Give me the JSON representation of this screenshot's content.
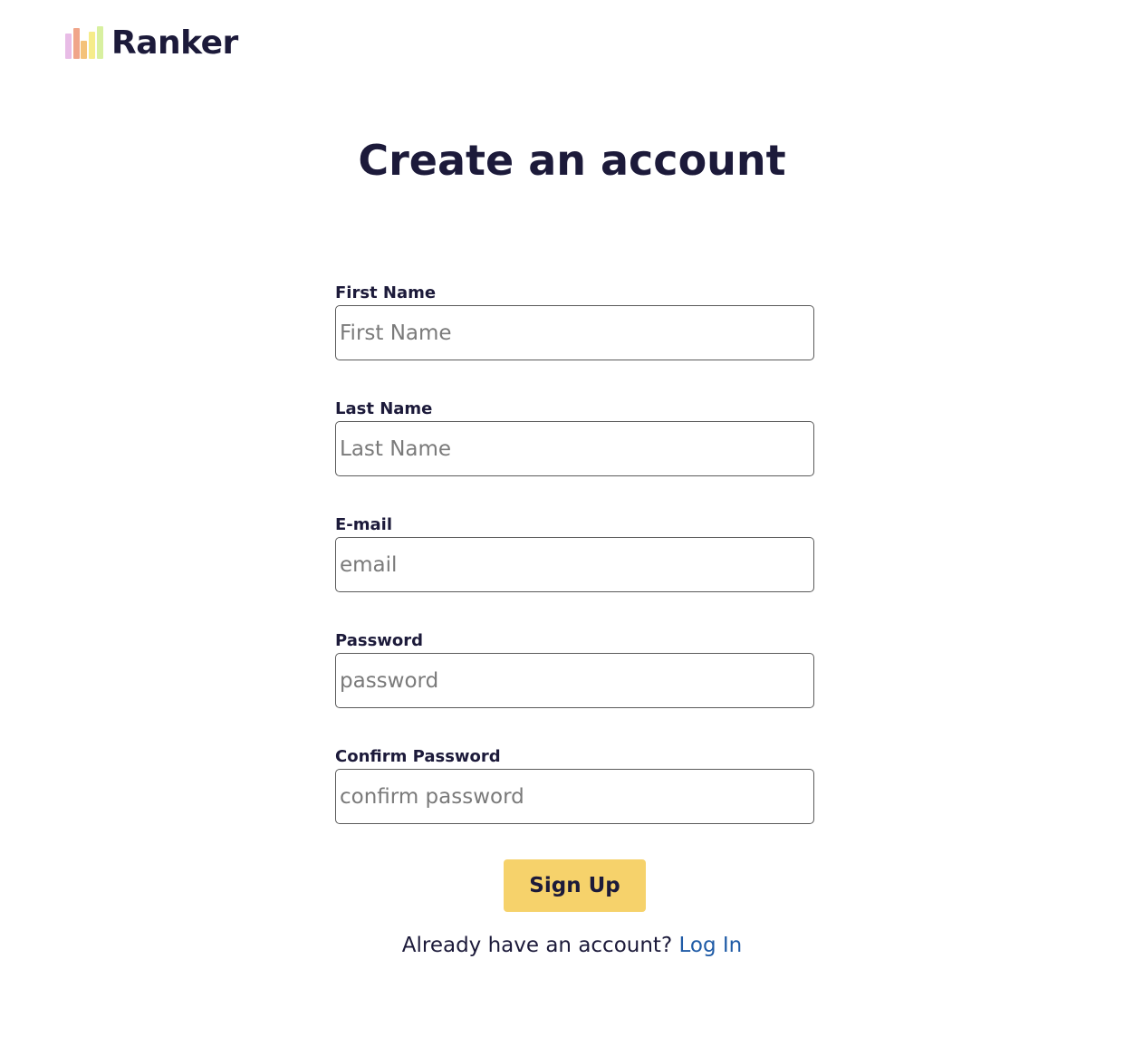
{
  "brand": {
    "name": "Ranker",
    "logo_colors": [
      "#e8bce6",
      "#f0a58a",
      "#f4c279",
      "#f6ec8a",
      "#d8f0a0"
    ]
  },
  "page_title": "Create an account",
  "form": {
    "fields": [
      {
        "label": "First Name",
        "placeholder": "First Name",
        "value": ""
      },
      {
        "label": "Last Name",
        "placeholder": "Last Name",
        "value": ""
      },
      {
        "label": "E-mail",
        "placeholder": "email",
        "value": ""
      },
      {
        "label": "Password",
        "placeholder": "password",
        "value": ""
      },
      {
        "label": "Confirm Password",
        "placeholder": "confirm password",
        "value": ""
      }
    ],
    "submit_label": "Sign Up"
  },
  "login_prompt": {
    "text": "Already have an account?",
    "link_label": "Log In"
  },
  "colors": {
    "text": "#1c1a3a",
    "button": "#f6d26b",
    "link": "#1f5ba6"
  }
}
